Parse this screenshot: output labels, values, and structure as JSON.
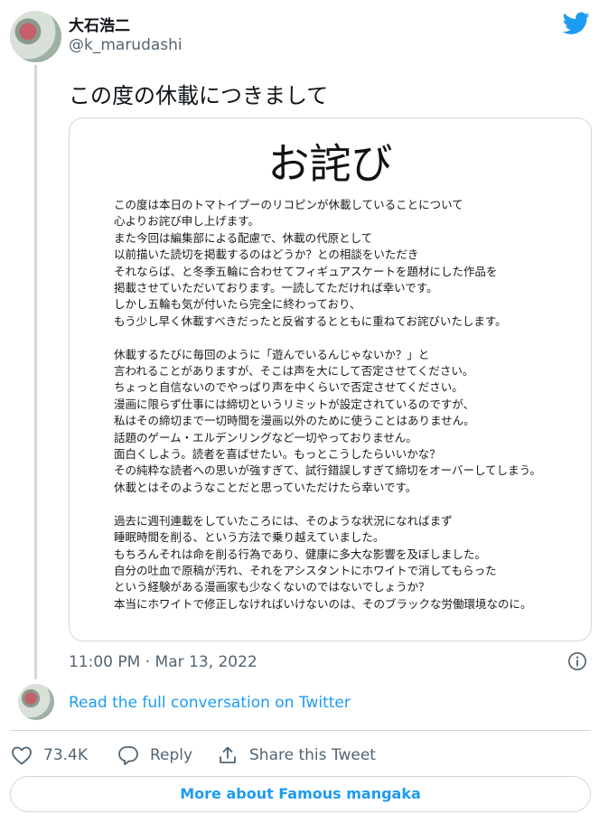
{
  "user": {
    "display_name": "大石浩二",
    "handle": "@k_marudashi"
  },
  "tweet": {
    "text": "この度の休載につきまして",
    "timestamp": "11:00 PM · Mar 13, 2022"
  },
  "image": {
    "title": "お詫び",
    "paragraphs": [
      [
        "この度は本日のトマトイプーのリコピンが休載していることについて",
        "心よりお詫び申し上げます。",
        "また今回は編集部による配慮で、休載の代原として",
        "以前描いた読切を掲載するのはどうか？との相談をいただき",
        "それならば、と冬季五輪に合わせてフィギュアスケートを題材にした作品を",
        "掲載させていただいております。一読してただければ幸いです。",
        "しかし五輪も気が付いたら完全に終わっており、",
        "もう少し早く休載すべきだったと反省するとともに重ねてお詫びいたします。"
      ],
      [
        "休載するたびに毎回のように「遊んでいるんじゃないか？」と",
        "言われることがありますが、そこは声を大にして否定させてください。",
        "ちょっと自信ないのでやっぱり声を中くらいで否定させてください。",
        "漫画に限らず仕事には締切というリミットが設定されているのですが、",
        "私はその締切まで一切時間を漫画以外のために使うことはありません。",
        "話題のゲーム・エルデンリングなど一切やっておりません。",
        "面白くしよう。読者を喜ばせたい。もっとこうしたらいいかな？",
        "その純粋な読者への思いが強すぎて、試行錯誤しすぎて締切をオーバーしてしまう。",
        "休載とはそのようなことだと思っていただけたら幸いです。"
      ],
      [
        "過去に週刊連載をしていたころには、そのような状況になればまず",
        "睡眠時間を削る、という方法で乗り越えていました。",
        "もちろんそれは命を削る行為であり、健康に多大な影響を及ぼしました。",
        "自分の吐血で原稿が汚れ、それをアシスタントにホワイトで消してもらった",
        "という経験がある漫画家も少なくないのではないでしょうか？",
        "本当にホワイトで修正しなければいけないのは、そのブラックな労働環境なのに。"
      ]
    ]
  },
  "links": {
    "read_conversation": "Read the full conversation on Twitter"
  },
  "actions": {
    "like_count": "73.4K",
    "reply_label": "Reply",
    "share_label": "Share this Tweet"
  },
  "more_button": {
    "label": "More about Famous mangaka"
  },
  "colors": {
    "accent": "#1d9bf0",
    "secondary_text": "#536471",
    "border": "#cfd9de"
  }
}
